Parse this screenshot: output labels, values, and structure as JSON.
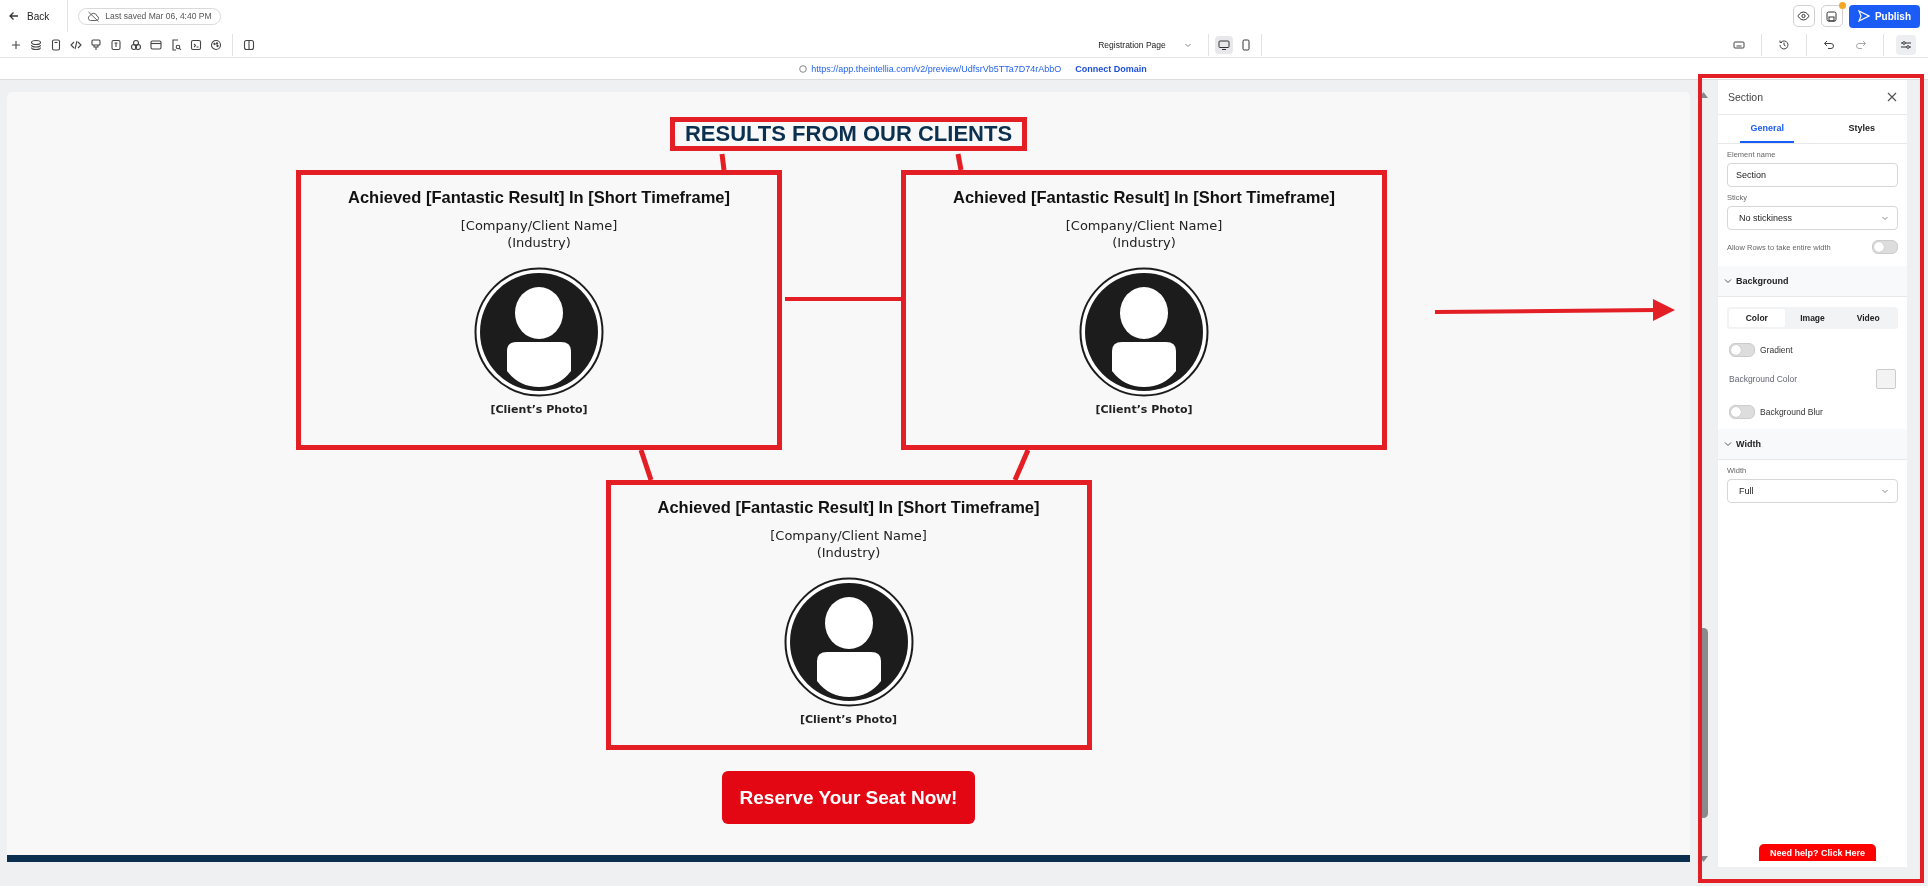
{
  "topbar": {
    "back": "Back",
    "saved_status": "Last saved Mar 06, 4:40 PM",
    "unsaved_changes": true,
    "publish": "Publish"
  },
  "toolbar": {
    "page_select": "Registration Page",
    "devices": [
      {
        "kind": "desktop",
        "selected": true
      },
      {
        "kind": "mobile",
        "selected": false
      }
    ],
    "settings_active": true
  },
  "url_bar": {
    "url": "https://app.theintellia.com/v2/preview/UdfsrVb5TTa7D74rAbbO",
    "link": "Connect Domain"
  },
  "canvas": {
    "heading": "RESULTS FROM OUR CLIENTS",
    "cards": [
      {
        "title": "Achieved [Fantastic Result] In [Short Timeframe]",
        "company": "[Company/Client Name]",
        "industry": "(Industry)",
        "caption": "[Client’s Photo]"
      },
      {
        "title": "Achieved [Fantastic Result] In [Short Timeframe]",
        "company": "[Company/Client Name]",
        "industry": "(Industry)",
        "caption": "[Client’s Photo]"
      },
      {
        "title": "Achieved [Fantastic Result] In [Short Timeframe]",
        "company": "[Company/Client Name]",
        "industry": "(Industry)",
        "caption": "[Client’s Photo]"
      }
    ],
    "cta": "Reserve Your Seat Now!"
  },
  "panel": {
    "title": "Section",
    "tabs": [
      {
        "label": "General",
        "selected": true
      },
      {
        "label": "Styles",
        "selected": false
      }
    ],
    "fields": [
      {
        "kind": "input",
        "label": "Element name",
        "value": "Section"
      },
      {
        "kind": "select",
        "label": "Sticky",
        "value": "No stickiness"
      },
      {
        "kind": "switch",
        "label": "Allow Rows to take entire width",
        "on": false
      },
      {
        "kind": "section",
        "label": "Background",
        "expanded": true
      },
      {
        "kind": "segmented",
        "options": [
          {
            "label": "Color",
            "selected": true
          },
          {
            "label": "Image",
            "selected": false
          },
          {
            "label": "Video",
            "selected": false
          }
        ]
      },
      {
        "kind": "toggle",
        "label": "Gradient",
        "on": false
      },
      {
        "kind": "color",
        "label": "Background Color",
        "color": "#f3f3f3"
      },
      {
        "kind": "toggle",
        "label": "Background Blur",
        "on": false
      },
      {
        "kind": "section",
        "label": "Width",
        "expanded": true
      },
      {
        "kind": "select",
        "label": "Width",
        "value": "Full"
      }
    ]
  },
  "help": "Need help? Click Here"
}
